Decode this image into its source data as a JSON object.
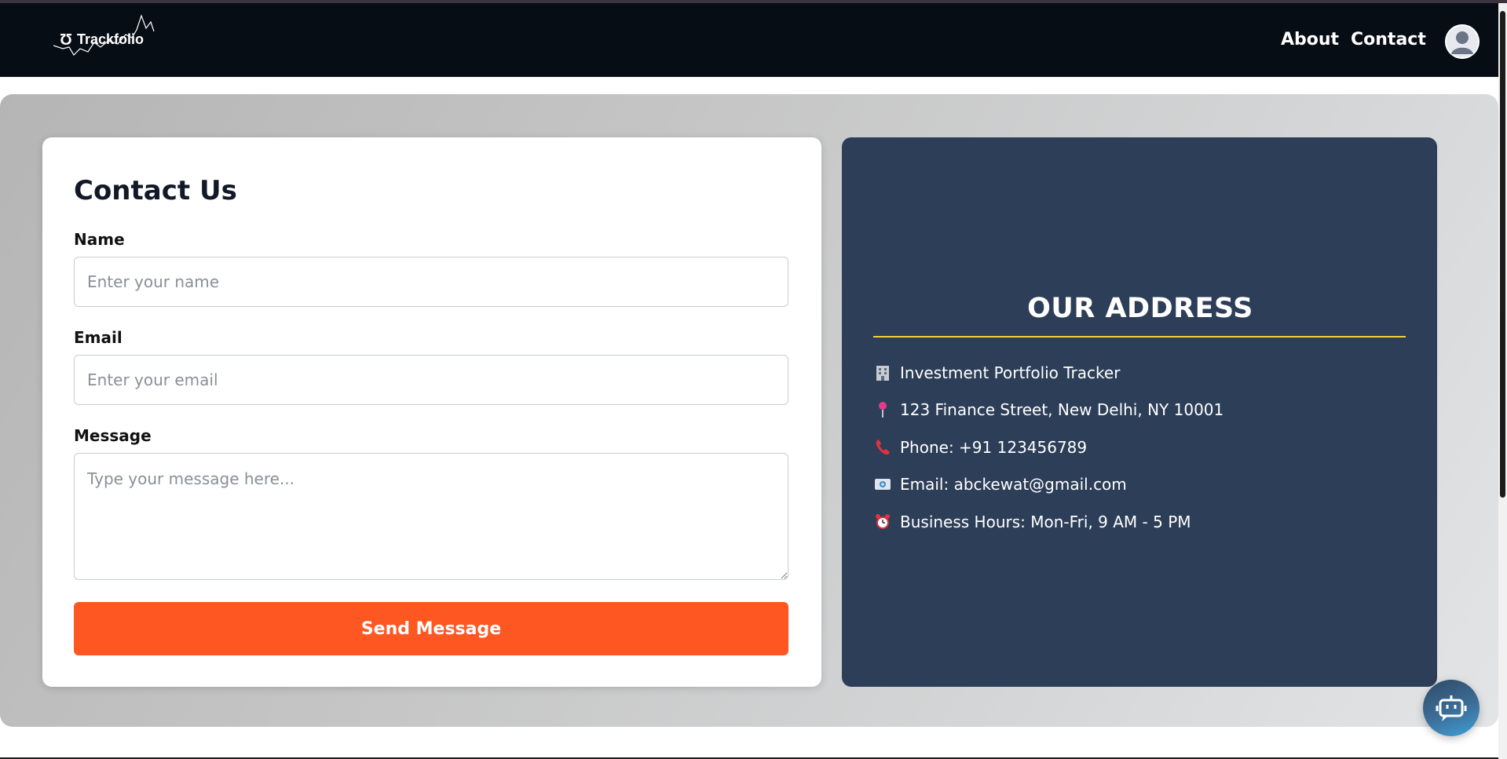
{
  "navbar": {
    "brand": "Trackfolio",
    "links": [
      "About",
      "Contact"
    ],
    "avatar_icon": "user-avatar-icon"
  },
  "contact_form": {
    "title": "Contact Us",
    "name_label": "Name",
    "name_placeholder": "Enter your name",
    "email_label": "Email",
    "email_placeholder": "Enter your email",
    "message_label": "Message",
    "message_placeholder": "Type your message here...",
    "submit_label": "Send Message"
  },
  "address": {
    "title": "OUR ADDRESS",
    "items": [
      {
        "icon": "office-building-icon",
        "text": "Investment Portfolio Tracker"
      },
      {
        "icon": "map-pin-icon",
        "text": "123 Finance Street, New Delhi, NY 10001"
      },
      {
        "icon": "telephone-icon",
        "text": "Phone: +91 123456789"
      },
      {
        "icon": "email-icon",
        "text": "Email: abckewat@gmail.com"
      },
      {
        "icon": "alarm-clock-icon",
        "text": "Business Hours: Mon-Fri, 9 AM - 5 PM"
      }
    ]
  },
  "chat_widget": {
    "icon": "chatbot-icon"
  },
  "colors": {
    "navbar_bg": "#070d15",
    "accent_button": "#ff5722",
    "address_card_bg": "#2d3e58",
    "address_rule": "#f4d03f"
  }
}
